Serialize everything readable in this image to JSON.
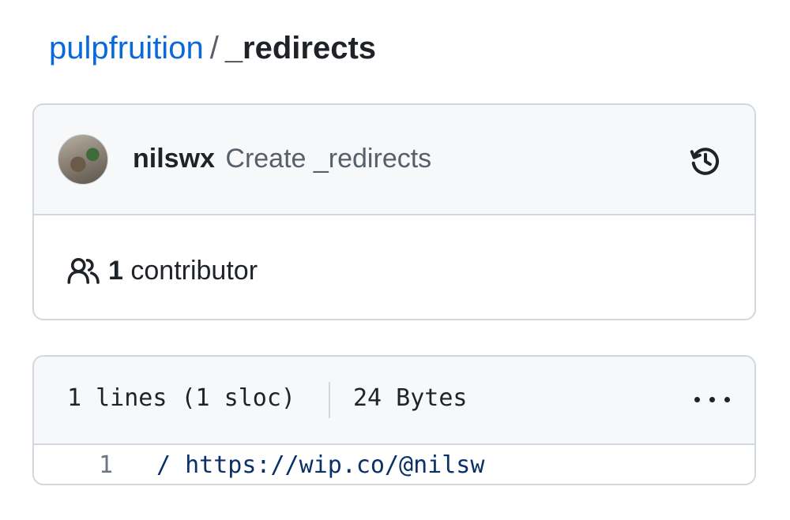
{
  "breadcrumb": {
    "repo": "pulpfruition",
    "separator": "/",
    "file": "_redirects"
  },
  "commit": {
    "author": "nilswx",
    "message": "Create _redirects"
  },
  "contributors": {
    "count": "1",
    "label": "contributor"
  },
  "file_info": {
    "lines": "1 lines (1 sloc)",
    "size": "24 Bytes"
  },
  "code": [
    {
      "line_number": "1",
      "text": "/ https://wip.co/@nilsw"
    }
  ],
  "icons": {
    "history": "history-icon",
    "people": "people-icon",
    "more": "kebab-horizontal-icon"
  },
  "colors": {
    "link": "#0969da",
    "border": "#d0d7de",
    "header_bg": "#f6f8fa",
    "code_text": "#0a3069"
  }
}
